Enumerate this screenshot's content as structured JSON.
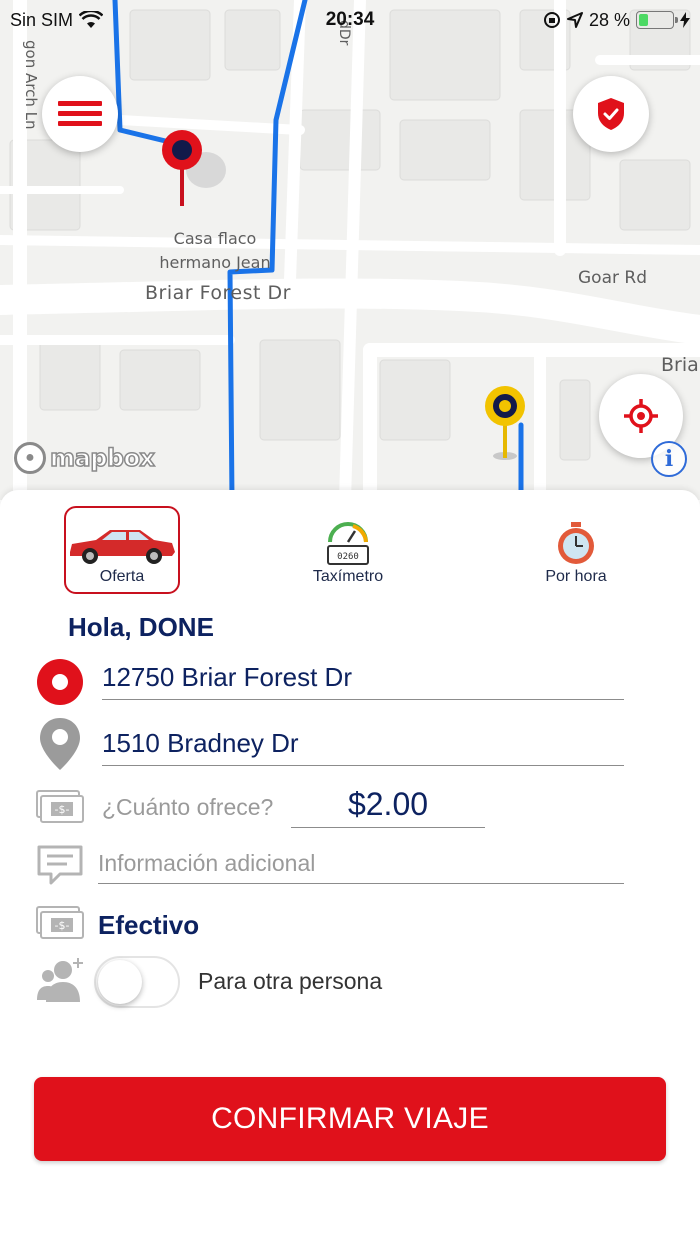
{
  "status_bar": {
    "carrier": "Sin SIM",
    "time": "20:34",
    "battery_percent": "28 %",
    "battery_level": 0.28
  },
  "map": {
    "street_labels": {
      "briar_forest": "Briar Forest Dr",
      "goar": "Goar Rd",
      "briar_cut": "Bria",
      "arch_ln": "gon Arch Ln",
      "dr_top": "dDr"
    },
    "poi_label_line1": "Casa flaco",
    "poi_label_line2": "hermano Jean",
    "attribution": "mapbox",
    "info_label": "i",
    "colors": {
      "route": "#1a73e8",
      "origin_pin": "#e0111b",
      "dest_pin": "#f2c300"
    }
  },
  "modes": [
    {
      "label": "Oferta",
      "icon": "car-icon",
      "selected": true
    },
    {
      "label": "Taxímetro",
      "icon": "taximeter-icon",
      "selected": false
    },
    {
      "label": "Por hora",
      "icon": "stopwatch-icon",
      "selected": false
    }
  ],
  "greeting": "Hola, DONE",
  "trip": {
    "origin": "12750 Briar Forest Dr",
    "destination": "1510 Bradney Dr",
    "offer_question": "¿Cuánto ofrece?",
    "offer_amount": "$2.00",
    "info_placeholder": "Información adicional",
    "payment_method": "Efectivo",
    "other_person_label": "Para otra persona",
    "other_person_enabled": false
  },
  "confirm_label": "CONFIRMAR VIAJE",
  "colors": {
    "brand_red": "#e0111b",
    "navy_text": "#0d2260"
  }
}
